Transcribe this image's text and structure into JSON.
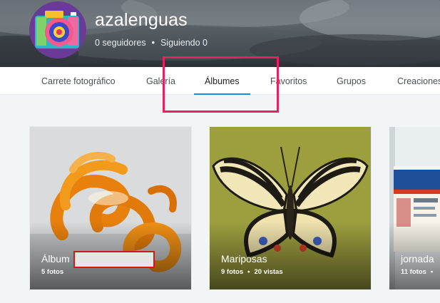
{
  "profile": {
    "username": "azalenguas",
    "followers": "0 seguidores",
    "following": "Siguiendo 0",
    "separator": "•"
  },
  "nav": {
    "tabs": [
      {
        "label": "Carrete fotográfico",
        "active": false
      },
      {
        "label": "Galería",
        "active": false
      },
      {
        "label": "Álbumes",
        "active": true
      },
      {
        "label": "Favoritos",
        "active": false
      },
      {
        "label": "Grupos",
        "active": false
      },
      {
        "label": "Creaciones",
        "active": false
      }
    ]
  },
  "albums": [
    {
      "title": "Álbum",
      "photos": "5 fotos",
      "views": "",
      "image": "orange-peel-spirals"
    },
    {
      "title": "Mariposas",
      "photos": "9 fotos",
      "views": "20 vistas",
      "image": "swallowtail-butterfly"
    },
    {
      "title": "jornada",
      "photos": "11 fotos",
      "views": "",
      "image": "jornada-poster"
    }
  ],
  "colors": {
    "accent": "#128fdc",
    "highlight_box": "#e8205f",
    "redaction_border": "#d01818"
  }
}
